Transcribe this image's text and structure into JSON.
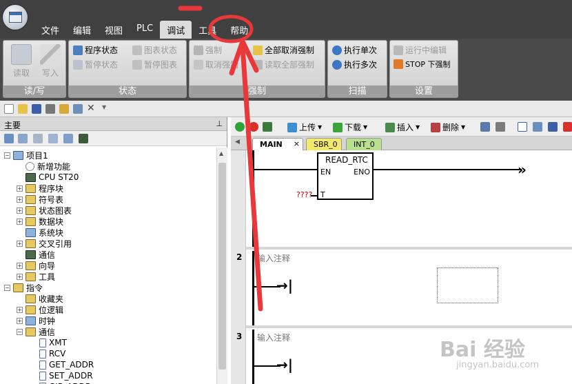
{
  "menu": {
    "tabs": [
      "文件",
      "编辑",
      "视图",
      "PLC",
      "调试",
      "工具",
      "帮助"
    ],
    "active": "调试"
  },
  "ribbon": {
    "groups": [
      "读/写",
      "状态",
      "强制",
      "扫描",
      "设置"
    ],
    "readwrite": {
      "read": "读取",
      "write": "写入"
    },
    "status": {
      "program_status": "程序状态",
      "pause_status": "暂停状态",
      "chart_status": "图表状态",
      "pause_chart": "暂停图表"
    },
    "force": {
      "force": "强制",
      "unforce": "取消强制",
      "unforce_all": "全部取消强制",
      "read_all_forced": "读取全部强制"
    },
    "scan": {
      "single": "执行单次",
      "multiple": "执行多次"
    },
    "settings": {
      "edit_in_run": "运行中编辑",
      "stop_force": "STOP 下强制"
    }
  },
  "panel": {
    "title": "主要",
    "pin": "ᵖ"
  },
  "tree": [
    {
      "label": "项目1",
      "level": 0,
      "expander": "−",
      "icon": "project-icon"
    },
    {
      "label": "新增功能",
      "level": 1,
      "expander": "",
      "icon": "help-icon"
    },
    {
      "label": "CPU ST20",
      "level": 1,
      "expander": "",
      "icon": "cpu-icon"
    },
    {
      "label": "程序块",
      "level": 1,
      "expander": "+",
      "icon": "folder-icon"
    },
    {
      "label": "符号表",
      "level": 1,
      "expander": "+",
      "icon": "folder-icon"
    },
    {
      "label": "状态图表",
      "level": 1,
      "expander": "+",
      "icon": "folder-icon"
    },
    {
      "label": "数据块",
      "level": 1,
      "expander": "+",
      "icon": "folder-icon"
    },
    {
      "label": "系统块",
      "level": 1,
      "expander": "",
      "icon": "system-block-icon"
    },
    {
      "label": "交叉引用",
      "level": 1,
      "expander": "+",
      "icon": "folder-icon"
    },
    {
      "label": "通信",
      "level": 1,
      "expander": "",
      "icon": "computer-icon"
    },
    {
      "label": "向导",
      "level": 1,
      "expander": "+",
      "icon": "wizard-icon"
    },
    {
      "label": "工具",
      "level": 1,
      "expander": "+",
      "icon": "tools-icon"
    },
    {
      "label": "指令",
      "level": 0,
      "expander": "−",
      "icon": "folder-icon"
    },
    {
      "label": "收藏夹",
      "level": 1,
      "expander": "",
      "icon": "folder-icon"
    },
    {
      "label": "位逻辑",
      "level": 1,
      "expander": "+",
      "icon": "folder-icon"
    },
    {
      "label": "时钟",
      "level": 1,
      "expander": "+",
      "icon": "clock-icon"
    },
    {
      "label": "通信",
      "level": 1,
      "expander": "−",
      "icon": "comm-icon"
    },
    {
      "label": "XMT",
      "level": 2,
      "expander": "",
      "icon": "instruction-icon"
    },
    {
      "label": "RCV",
      "level": 2,
      "expander": "",
      "icon": "instruction-icon"
    },
    {
      "label": "GET_ADDR",
      "level": 2,
      "expander": "",
      "icon": "instruction-icon"
    },
    {
      "label": "SET_ADDR",
      "level": 2,
      "expander": "",
      "icon": "instruction-icon"
    },
    {
      "label": "GIP_ADDR",
      "level": 2,
      "expander": "",
      "icon": "instruction-icon"
    }
  ],
  "editor": {
    "toolbar": {
      "upload": "上传",
      "download": "下载",
      "insert": "插入",
      "delete": "删除"
    },
    "tabs": [
      "MAIN",
      "SBR_0",
      "INT_0"
    ],
    "tab_close": "×",
    "rung1": {
      "block": "READ_RTC",
      "en": "EN",
      "eno": "ENO",
      "t_pin": "T",
      "t_value": "????"
    },
    "rung2": {
      "num": "2",
      "comment": "输入注释"
    },
    "rung3": {
      "num": "3",
      "comment": "输入注释"
    }
  },
  "watermark": {
    "main": "Bai 经验",
    "sub": "jingyan.baidu.com"
  },
  "colors": {
    "accent_red": "#e8383a",
    "menu_bg": "#404040",
    "tab_sbr": "#f5e96b",
    "tab_int": "#b9e08e"
  }
}
